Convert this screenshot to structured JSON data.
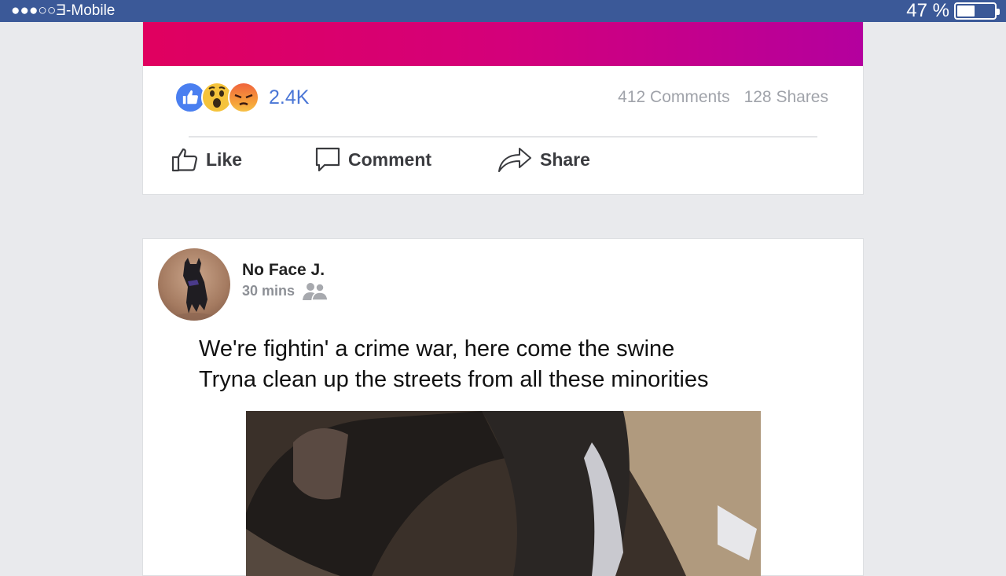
{
  "status_bar": {
    "carrier": "●●●○○Ǝ-Mobile",
    "battery_percent": "47 %",
    "battery_level": 0.47
  },
  "top_post": {
    "reactions_count": "2.4K",
    "reactions": [
      "like-reaction-icon",
      "wow-reaction-icon",
      "angry-reaction-icon"
    ],
    "comments": "412 Comments",
    "shares": "128 Shares",
    "actions": {
      "like": "Like",
      "comment": "Comment",
      "share": "Share"
    }
  },
  "post": {
    "author": "No Face J.",
    "time": "30 mins",
    "privacy_icon": "friends-icon",
    "lines": [
      "We're fightin' a crime war, here come the swine",
      "Tryna clean up the streets from all these minorities"
    ]
  },
  "colors": {
    "status_bar": "#3b5998",
    "reaction_count": "#4a76d6",
    "banner_start": "#e0005f",
    "banner_end": "#b4009e"
  }
}
